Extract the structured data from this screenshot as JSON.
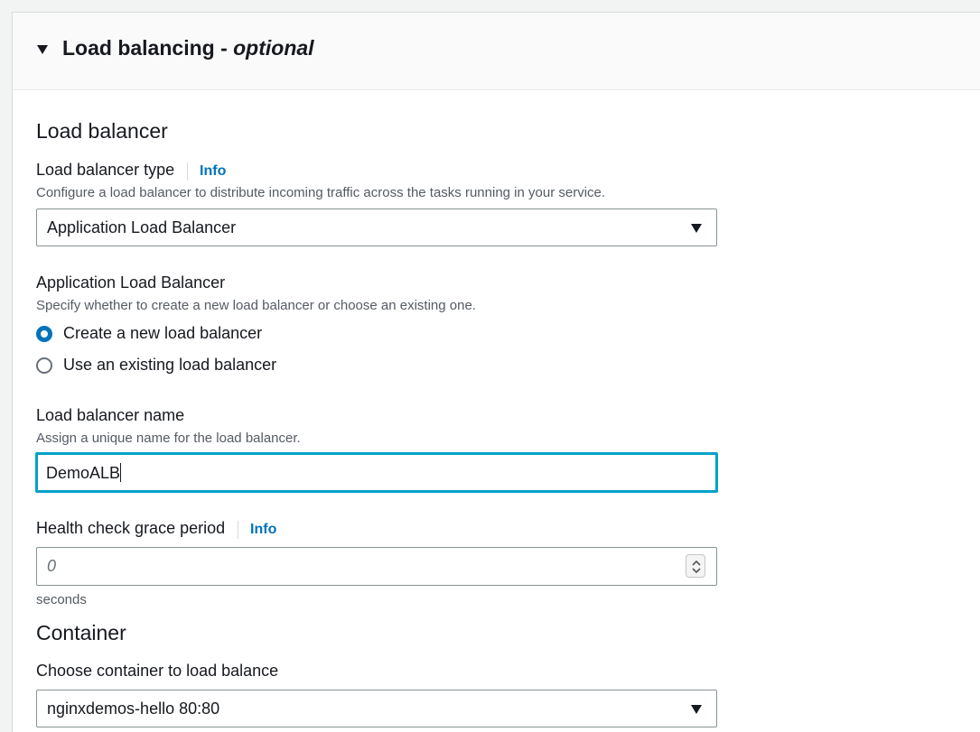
{
  "section": {
    "title_main": "Load balancing - ",
    "title_optional": "optional"
  },
  "load_balancer": {
    "heading": "Load balancer",
    "type_label": "Load balancer type",
    "type_info": "Info",
    "type_description": "Configure a load balancer to distribute incoming traffic across the tasks running in your service.",
    "type_value": "Application Load Balancer"
  },
  "alb": {
    "label": "Application Load Balancer",
    "description": "Specify whether to create a new load balancer or choose an existing one.",
    "options": [
      {
        "label": "Create a new load balancer",
        "selected": true
      },
      {
        "label": "Use an existing load balancer",
        "selected": false
      }
    ]
  },
  "lb_name": {
    "label": "Load balancer name",
    "description": "Assign a unique name for the load balancer.",
    "value": "DemoALB"
  },
  "health_check": {
    "label": "Health check grace period",
    "info": "Info",
    "placeholder": "0",
    "unit": "seconds"
  },
  "container": {
    "heading": "Container",
    "label": "Choose container to load balance",
    "value": "nginxdemos-hello 80:80"
  },
  "colors": {
    "accent": "#0073bb",
    "focus_border": "#00a1c9",
    "text": "#16191f",
    "secondary_text": "#545b64"
  },
  "icons": {
    "section_toggle": "caret-down-icon",
    "select_arrow": "caret-down-icon",
    "spinner": "up-down-chevron-icon"
  }
}
